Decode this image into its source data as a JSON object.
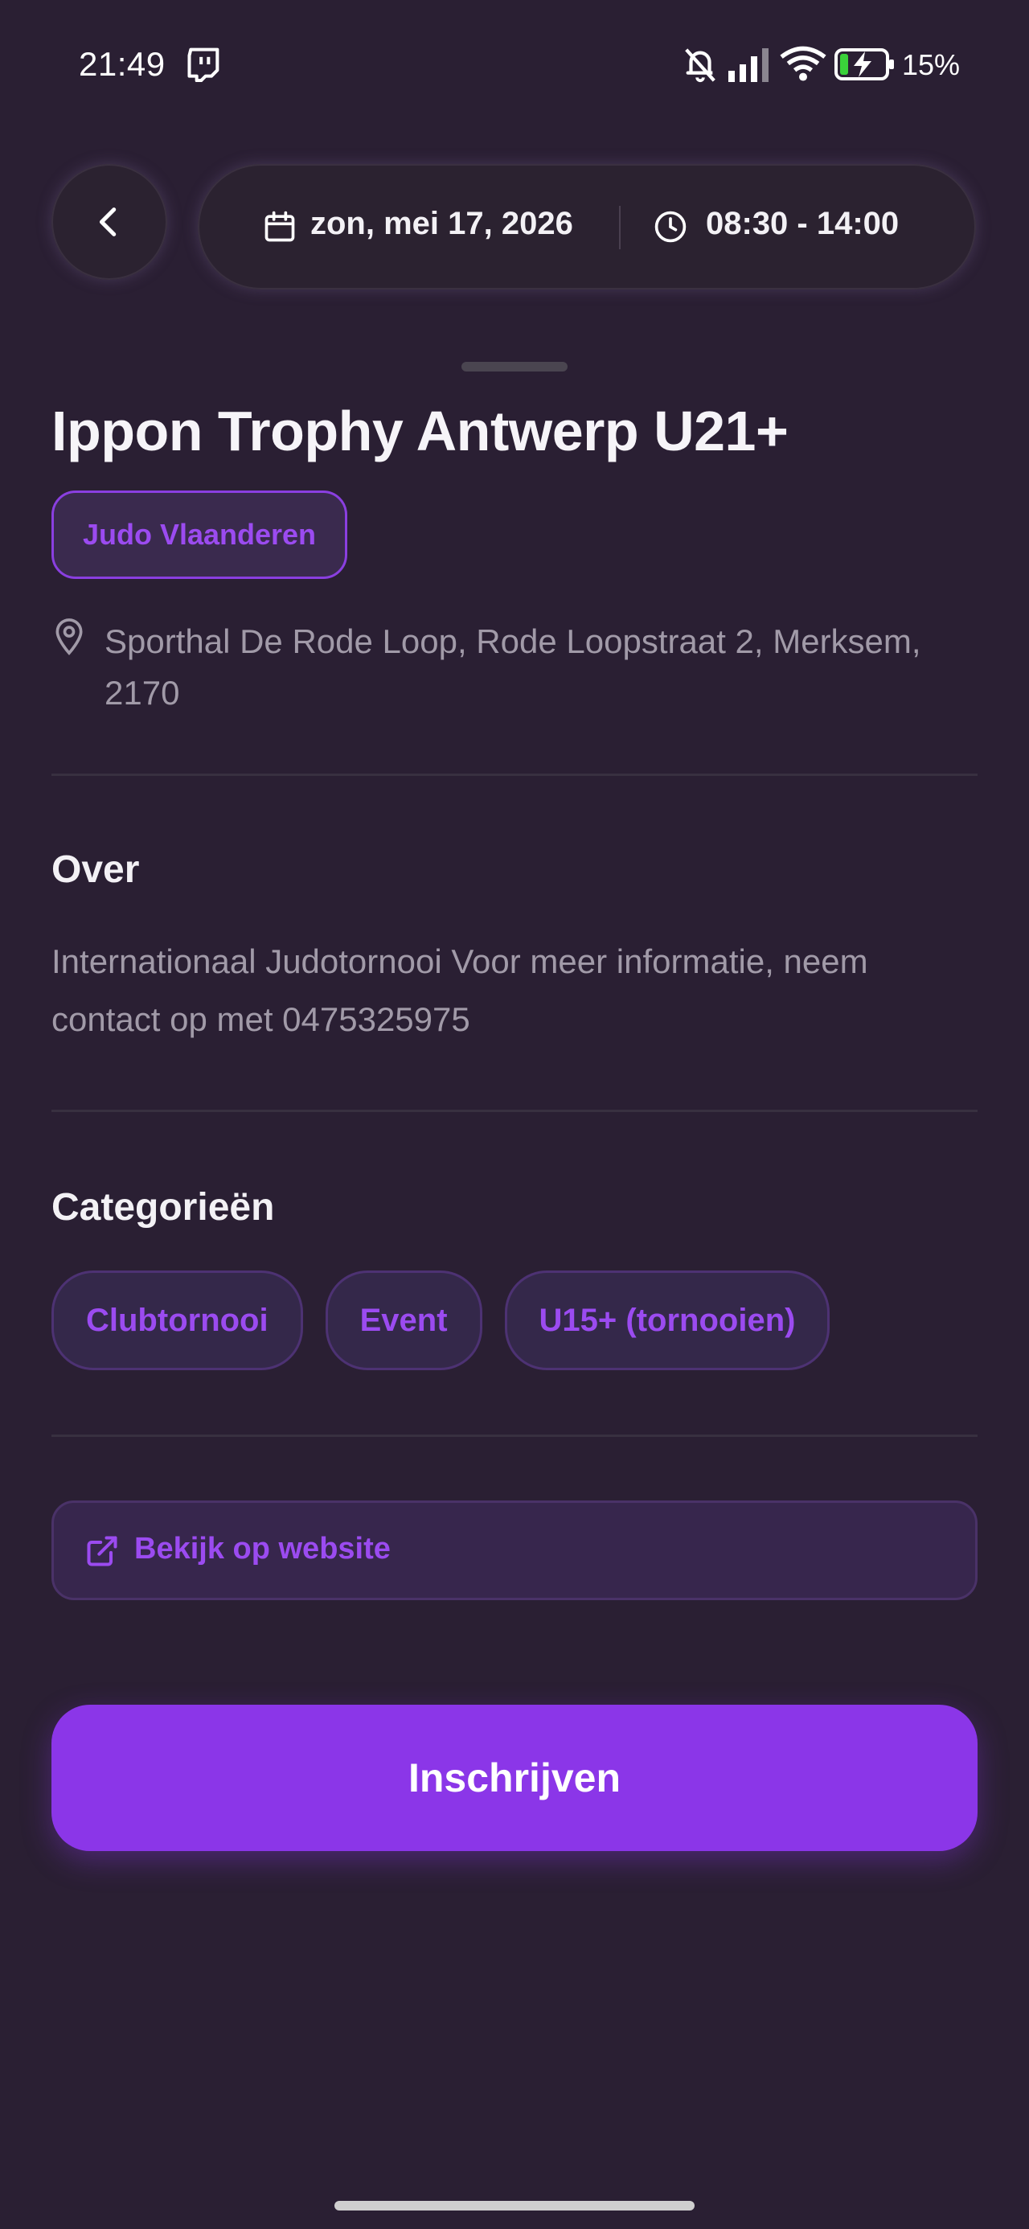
{
  "status_bar": {
    "time": "21:49",
    "battery": "15%"
  },
  "header": {
    "date": "zon, mei 17, 2026",
    "time_range": "08:30 - 14:00"
  },
  "event": {
    "title": "Ippon Trophy Antwerp U21+",
    "organizer": "Judo Vlaanderen",
    "address": "Sporthal De Rode Loop, Rode Loopstraat 2, Merksem, 2170"
  },
  "about": {
    "heading": "Over",
    "text": "Internationaal Judotornooi Voor meer informatie, neem contact op met  0475325975"
  },
  "categories": {
    "heading": "Categorieën",
    "items": [
      "Clubtornooi",
      "Event",
      "U15+ (tornooien)"
    ]
  },
  "actions": {
    "website_label": "Bekijk op website",
    "register_label": "Inschrijven"
  },
  "colors": {
    "background": "#2a1f33",
    "accent": "#8b36e8",
    "accent_text": "#9b4bf0",
    "muted_text": "#a19aa8"
  },
  "icons": [
    "twitch-icon",
    "bell-off-icon",
    "signal-icon",
    "wifi-icon",
    "battery-charging-icon",
    "back-arrow-icon",
    "calendar-icon",
    "clock-icon",
    "map-pin-icon",
    "external-link-icon"
  ]
}
